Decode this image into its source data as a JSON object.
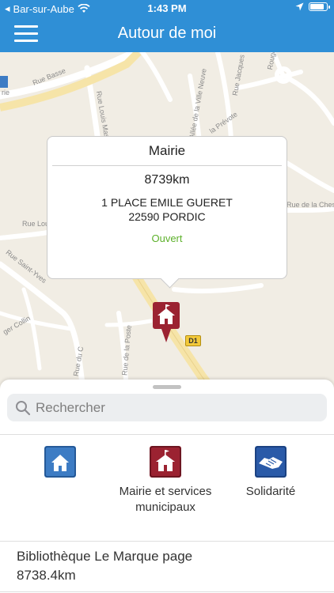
{
  "status_bar": {
    "back_app": "Bar-sur-Aube",
    "time": "1:43 PM",
    "battery_level": 0.9
  },
  "nav": {
    "title": "Autour de moi"
  },
  "map": {
    "road_labels": {
      "rue_basse": "Rue Basse",
      "rue_louis_mass": "Rue Louis Mass",
      "allee_ville_neuve": "Allée de la Ville Neuve",
      "rue_jacques": "Rue Jacques",
      "la_prevote": "la Prévote",
      "rue_chesnai": "Rue de la Chesnai",
      "rue_lou": "Rue Lou",
      "rue_saint_yves": "Rue Saint-Yves",
      "ger_collin": "ger Collin",
      "rue_de_la_poste": "Rue de la Poste",
      "rue_du_c": "Rue du C",
      "rouge": "Rouge",
      "rie": "rie"
    },
    "road_badge": "D1",
    "popup": {
      "title": "Mairie",
      "distance": "8739km",
      "address_line1": "1 PLACE EMILE GUERET",
      "address_line2": "22590 PORDIC",
      "status": "Ouvert"
    },
    "marker_icon": "town-hall-icon"
  },
  "search": {
    "placeholder": "Rechercher"
  },
  "categories": [
    {
      "label": "",
      "icon": "home-icon",
      "color": "#3d7cc4"
    },
    {
      "label": "Mairie et services municipaux",
      "icon": "town-hall-icon",
      "color": "#9b2231"
    },
    {
      "label": "Solidarité",
      "icon": "handshake-icon",
      "color": "#2a5aa8"
    }
  ],
  "results": [
    {
      "name": "Bibliothèque Le Marque page",
      "distance": "8738.4km"
    }
  ],
  "colors": {
    "accent": "#2f8fd6",
    "open_status": "#5db12b",
    "map_background": "#f1ede4"
  }
}
